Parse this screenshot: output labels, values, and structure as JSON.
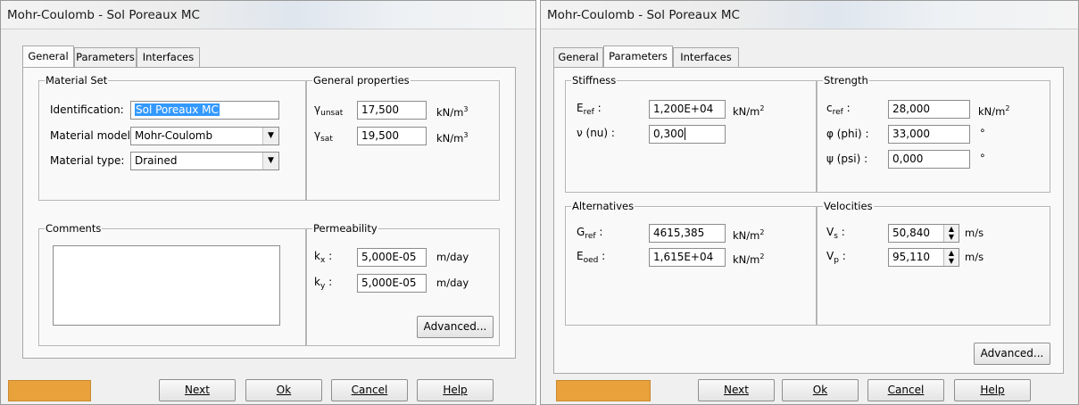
{
  "left": {
    "window_title": "Mohr-Coulomb - Sol Poreaux MC",
    "tabs": [
      "General",
      "Parameters",
      "Interfaces"
    ],
    "material_set": {
      "title": "Material Set",
      "identification_label": "Identification:",
      "identification_value": "Sol Poreaux MC",
      "model_label": "Material model:",
      "model_value": "Mohr-Coulomb",
      "type_label": "Material type:",
      "type_value": "Drained"
    },
    "general_properties": {
      "title": "General properties",
      "gamma_unsat_value": "17,500",
      "gamma_sat_value": "19,500",
      "unit_main": "kN/m",
      "unit_exp": "3"
    },
    "comments": {
      "title": "Comments"
    },
    "permeability": {
      "title": "Permeability",
      "kx_value": "5,000E-05",
      "ky_value": "5,000E-05",
      "unit": "m/day",
      "advanced_label": "Advanced..."
    },
    "buttons": {
      "next": "Next",
      "ok": "Ok",
      "cancel": "Cancel",
      "help": "Help"
    }
  },
  "right": {
    "window_title": "Mohr-Coulomb - Sol Poreaux MC",
    "tabs": [
      "General",
      "Parameters",
      "Interfaces"
    ],
    "stiffness": {
      "title": "Stiffness",
      "eref_value": "1,200E+04",
      "nu_label": "ν (nu) :",
      "nu_value": "0,300"
    },
    "strength": {
      "title": "Strength",
      "cref_value": "28,000",
      "phi_label": "φ (phi) :",
      "phi_value": "33,000",
      "psi_label": "ψ (psi) :",
      "psi_value": "0,000",
      "degree": "°"
    },
    "alternatives": {
      "title": "Alternatives",
      "gref_value": "4615,385",
      "eoed_value": "1,615E+04"
    },
    "velocities": {
      "title": "Velocities",
      "vs_value": "50,840",
      "vp_value": "95,110",
      "unit": "m/s"
    },
    "units": {
      "kn_main": "kN/m",
      "kn_exp": "2"
    },
    "advanced_label": "Advanced...",
    "buttons": {
      "next": "Next",
      "ok": "Ok",
      "cancel": "Cancel",
      "help": "Help"
    }
  },
  "colors": {
    "orange_swatch": "#e8a13b",
    "selection": "#3399ff"
  },
  "icons": [
    "dropdown-arrow-icon",
    "spin-arrows-icon"
  ]
}
